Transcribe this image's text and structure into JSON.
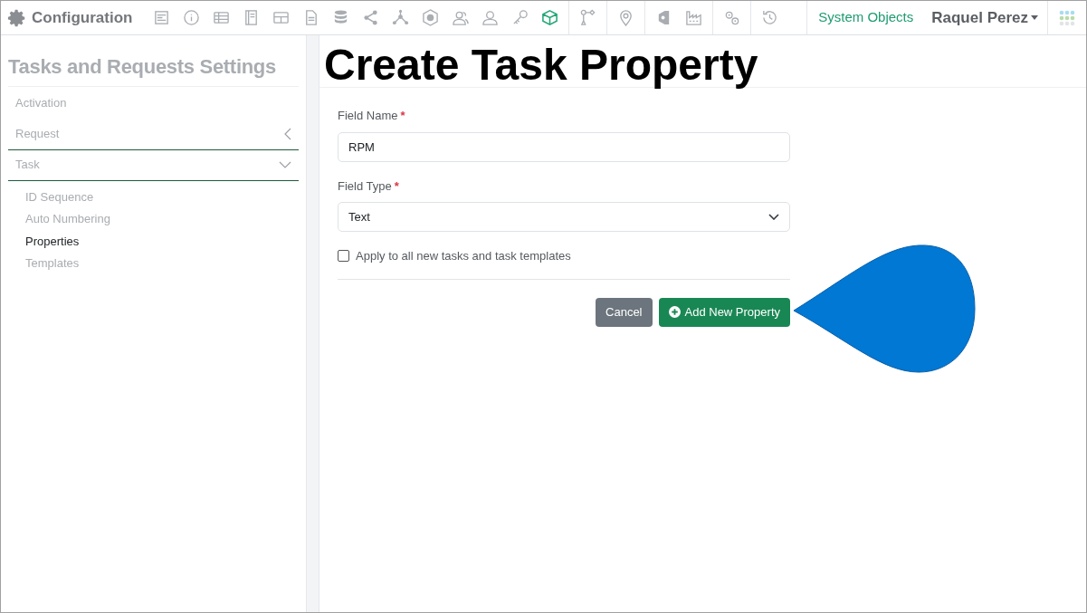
{
  "app": {
    "title": "Configuration"
  },
  "toolbar_groups": [
    [
      {
        "kind": "form",
        "selected": false
      },
      {
        "kind": "info",
        "selected": false
      },
      {
        "kind": "table",
        "selected": false
      },
      {
        "kind": "book",
        "selected": false
      },
      {
        "kind": "grid",
        "selected": false
      },
      {
        "kind": "document",
        "selected": false
      },
      {
        "kind": "database",
        "selected": false
      },
      {
        "kind": "share",
        "selected": false
      },
      {
        "kind": "network",
        "selected": false
      },
      {
        "kind": "badge",
        "selected": false
      },
      {
        "kind": "users",
        "selected": false
      },
      {
        "kind": "user",
        "selected": false
      },
      {
        "kind": "key",
        "selected": false
      },
      {
        "kind": "cube",
        "selected": true
      }
    ],
    [
      {
        "kind": "workflow",
        "selected": false
      }
    ],
    [
      {
        "kind": "pin",
        "selected": false
      }
    ],
    [
      {
        "kind": "tag",
        "selected": false
      },
      {
        "kind": "factory",
        "selected": false
      }
    ],
    [
      {
        "kind": "gears",
        "selected": false
      }
    ],
    [
      {
        "kind": "history",
        "selected": false
      }
    ]
  ],
  "system_objects": "System Objects",
  "user": {
    "name": "Raquel Perez"
  },
  "sidebar": {
    "title": "Tasks and Requests Settings",
    "items": [
      {
        "label": "Activation",
        "kind": "link"
      },
      {
        "label": "Request",
        "kind": "group",
        "expanded": false
      },
      {
        "label": "Task",
        "kind": "group",
        "expanded": true,
        "children": [
          {
            "label": "ID Sequence",
            "selected": false
          },
          {
            "label": "Auto Numbering",
            "selected": false
          },
          {
            "label": "Properties",
            "selected": true
          },
          {
            "label": "Templates",
            "selected": false
          }
        ]
      }
    ]
  },
  "page": {
    "title": "Create Task Property",
    "fields": [
      {
        "kind": "text",
        "label": "Field Name",
        "required": true,
        "value": "RPM"
      },
      {
        "kind": "select",
        "label": "Field Type",
        "required": true,
        "value": "Text"
      },
      {
        "kind": "checkbox",
        "label": "Apply to all new tasks and task templates",
        "checked": false
      }
    ],
    "required_mark": "*",
    "buttons": [
      {
        "kind": "secondary",
        "label": "Cancel"
      },
      {
        "kind": "primary",
        "label": "Add New Property"
      }
    ]
  }
}
